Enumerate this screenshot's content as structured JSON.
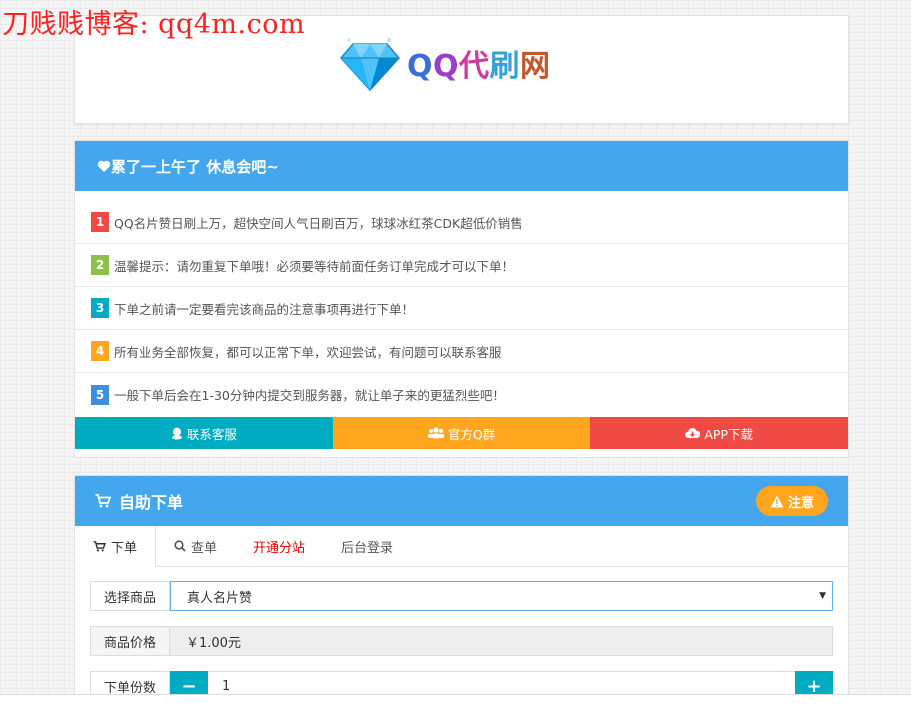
{
  "watermark": "刀贱贱博客: qq4m.com",
  "logo": {
    "text_parts": [
      "Q",
      "Q",
      "代",
      "刷",
      "网"
    ],
    "icon": "diamond-icon"
  },
  "notice": {
    "title": "累了一上午了 休息会吧~",
    "title_icon": "heart-icon",
    "items": [
      {
        "num": "1",
        "color": "#f04a45",
        "text": "QQ名片赞日刷上万，超快空间人气日刷百万，球球冰红茶CDK超低价销售"
      },
      {
        "num": "2",
        "color": "#8bc34a",
        "text": "温馨提示：请勿重复下单哦！必须要等待前面任务订单完成才可以下单！"
      },
      {
        "num": "3",
        "color": "#00acc1",
        "text": "下单之前请一定要看完该商品的注意事项再进行下单！"
      },
      {
        "num": "4",
        "color": "#ffa51e",
        "text": "所有业务全部恢复，都可以正常下单，欢迎尝试，有问题可以联系客服"
      },
      {
        "num": "5",
        "color": "#3d8fe0",
        "text": "一般下单后会在1-30分钟内提交到服务器，就让单子来的更猛烈些吧！"
      }
    ],
    "buttons": [
      {
        "label": "联系客服",
        "icon": "qq-icon"
      },
      {
        "label": "官方Q群",
        "icon": "group-icon"
      },
      {
        "label": "APP下载",
        "icon": "cloud-download-icon"
      }
    ]
  },
  "order": {
    "title": "自助下单",
    "title_icon": "cart-icon",
    "note_label": "注意",
    "tabs": [
      {
        "label": "下单",
        "icon": "cart-icon"
      },
      {
        "label": "查单",
        "icon": "search-icon"
      },
      {
        "label": "开通分站"
      },
      {
        "label": "后台登录"
      }
    ],
    "product_label": "选择商品",
    "product_value": "真人名片赞",
    "price_label": "商品价格",
    "price_value": "￥1.00元",
    "qty_label": "下单份数",
    "qty_value": "1",
    "minus": "−",
    "plus": "+"
  }
}
